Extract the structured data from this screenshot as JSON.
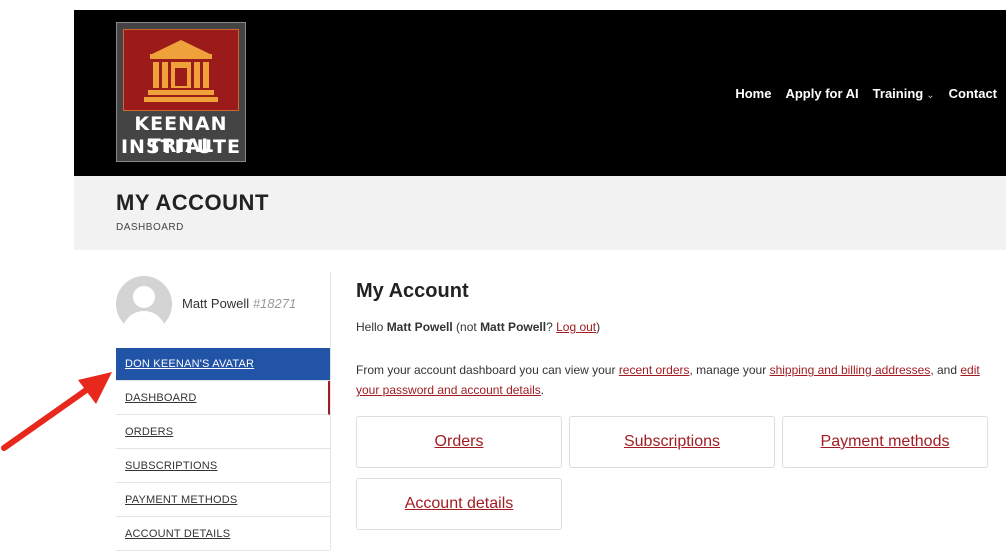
{
  "logo": {
    "line1": "KEENAN TRIAL",
    "line2": "INSTITUTE"
  },
  "nav": {
    "home": "Home",
    "apply": "Apply for AI",
    "training": "Training",
    "contact": "Contact"
  },
  "title_band": {
    "title": "MY ACCOUNT",
    "breadcrumb": "DASHBOARD"
  },
  "user": {
    "name": "Matt Powell",
    "id": "#18271"
  },
  "sidebar": {
    "items": [
      {
        "label": "DON KEENAN'S AVATAR"
      },
      {
        "label": "DASHBOARD"
      },
      {
        "label": "ORDERS"
      },
      {
        "label": "SUBSCRIPTIONS"
      },
      {
        "label": "PAYMENT METHODS"
      },
      {
        "label": "ACCOUNT DETAILS"
      }
    ]
  },
  "main": {
    "title": "My Account",
    "hello": {
      "prefix": "Hello ",
      "name": "Matt Powell",
      "mid": " (not ",
      "name2": "Matt Powell",
      "q": "? ",
      "logout": "Log out",
      "end": ")"
    },
    "intro": {
      "p1": "From your account dashboard you can view your ",
      "l1": "recent orders",
      "p2": ", manage your ",
      "l2": "shipping and billing addresses",
      "p3": ", and ",
      "l3": "edit your password and account details",
      "p4": "."
    },
    "cards": [
      "Orders",
      "Subscriptions",
      "Payment methods",
      "Account details"
    ]
  },
  "colors": {
    "header_bg": "#000000",
    "accent_red": "#a21d22",
    "highlight_blue": "#2154a6"
  }
}
